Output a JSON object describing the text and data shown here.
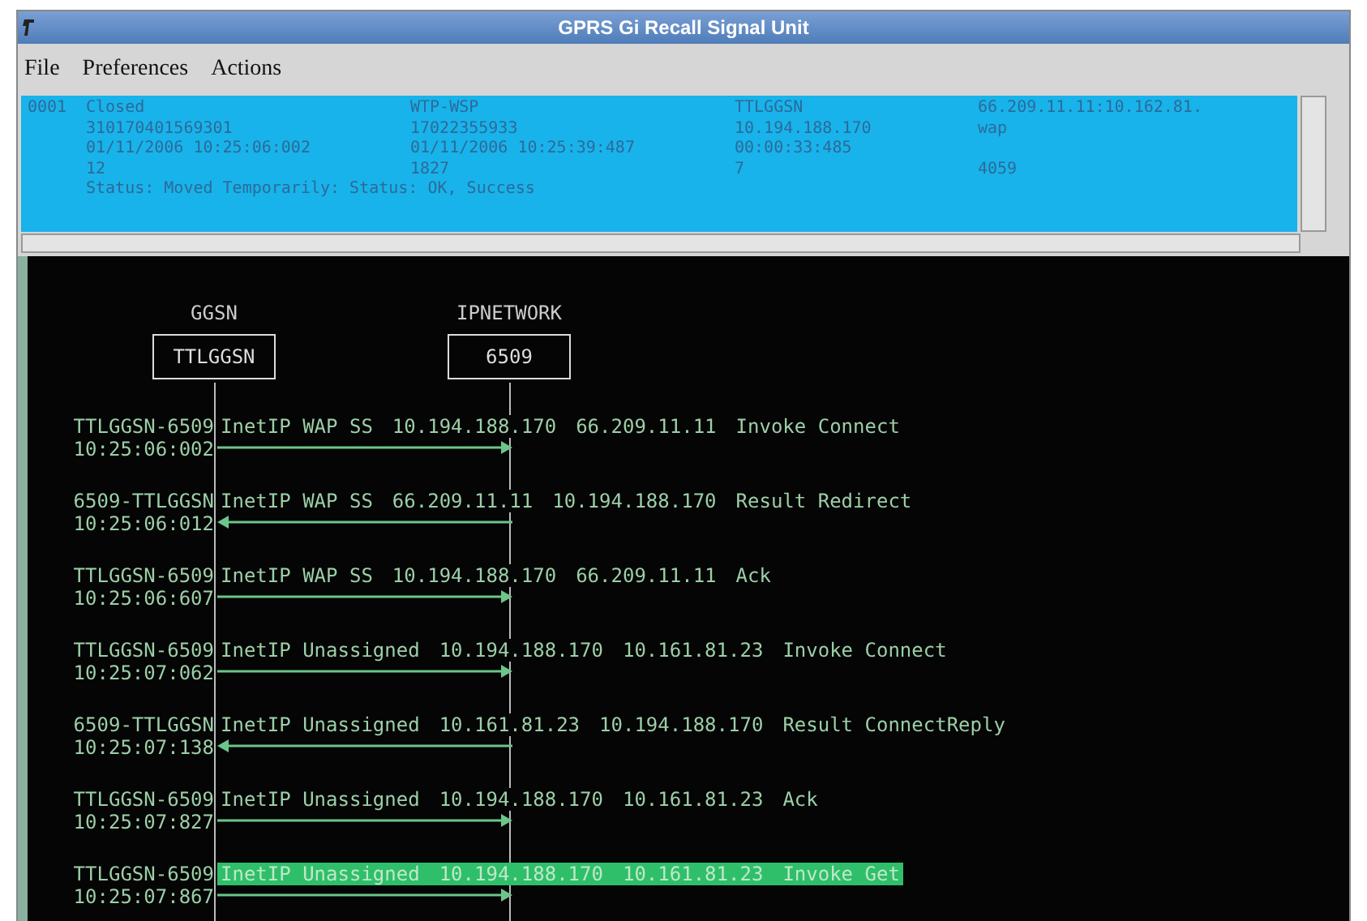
{
  "window": {
    "title": "GPRS Gi Recall Signal Unit"
  },
  "menu": [
    "File",
    "Preferences",
    "Actions"
  ],
  "record": {
    "id": "0001",
    "columns": [
      [
        "Closed",
        "310170401569301",
        "01/11/2006 10:25:06:002",
        "12"
      ],
      [
        "WTP-WSP",
        "17022355933",
        "01/11/2006 10:25:39:487",
        "1827"
      ],
      [
        "TTLGGSN",
        "10.194.188.170",
        "00:00:33:485",
        "7"
      ],
      [
        "66.209.11.11:10.162.81.",
        "wap",
        null,
        "4059"
      ]
    ],
    "status": "Status: Moved Temporarily: Status: OK, Success",
    "selected": true
  },
  "diagram": {
    "nodes": [
      {
        "type": "GGSN",
        "name": "TTLGGSN"
      },
      {
        "type": "IPNETWORK",
        "name": "6509"
      }
    ],
    "messages": [
      {
        "pair": "TTLGGSN-6509",
        "time": "10:25:06:002",
        "fields": [
          "InetIP WAP SS",
          "10.194.188.170",
          "66.209.11.11",
          "Invoke Connect"
        ],
        "kind": "forward",
        "selected": false
      },
      {
        "pair": "6509-TTLGGSN",
        "time": "10:25:06:012",
        "fields": [
          "InetIP WAP SS",
          "66.209.11.11",
          "10.194.188.170",
          "Result Redirect"
        ],
        "kind": "back",
        "selected": false
      },
      {
        "pair": "TTLGGSN-6509",
        "time": "10:25:06:607",
        "fields": [
          "InetIP WAP SS",
          "10.194.188.170",
          "66.209.11.11",
          "Ack"
        ],
        "kind": "forward",
        "selected": false
      },
      {
        "pair": "TTLGGSN-6509",
        "time": "10:25:07:062",
        "fields": [
          "InetIP Unassigned",
          "10.194.188.170",
          "10.161.81.23",
          "Invoke Connect"
        ],
        "kind": "forward",
        "selected": false
      },
      {
        "pair": "6509-TTLGGSN",
        "time": "10:25:07:138",
        "fields": [
          "InetIP Unassigned",
          "10.161.81.23",
          "10.194.188.170",
          "Result ConnectReply"
        ],
        "kind": "back",
        "selected": false
      },
      {
        "pair": "TTLGGSN-6509",
        "time": "10:25:07:827",
        "fields": [
          "InetIP Unassigned",
          "10.194.188.170",
          "10.161.81.23",
          "Ack"
        ],
        "kind": "forward",
        "selected": false
      },
      {
        "pair": "TTLGGSN-6509",
        "time": "10:25:07:867",
        "fields": [
          "InetIP Unassigned",
          "10.194.188.170",
          "10.161.81.23",
          "Invoke Get"
        ],
        "kind": "forward",
        "selected": true
      }
    ]
  }
}
